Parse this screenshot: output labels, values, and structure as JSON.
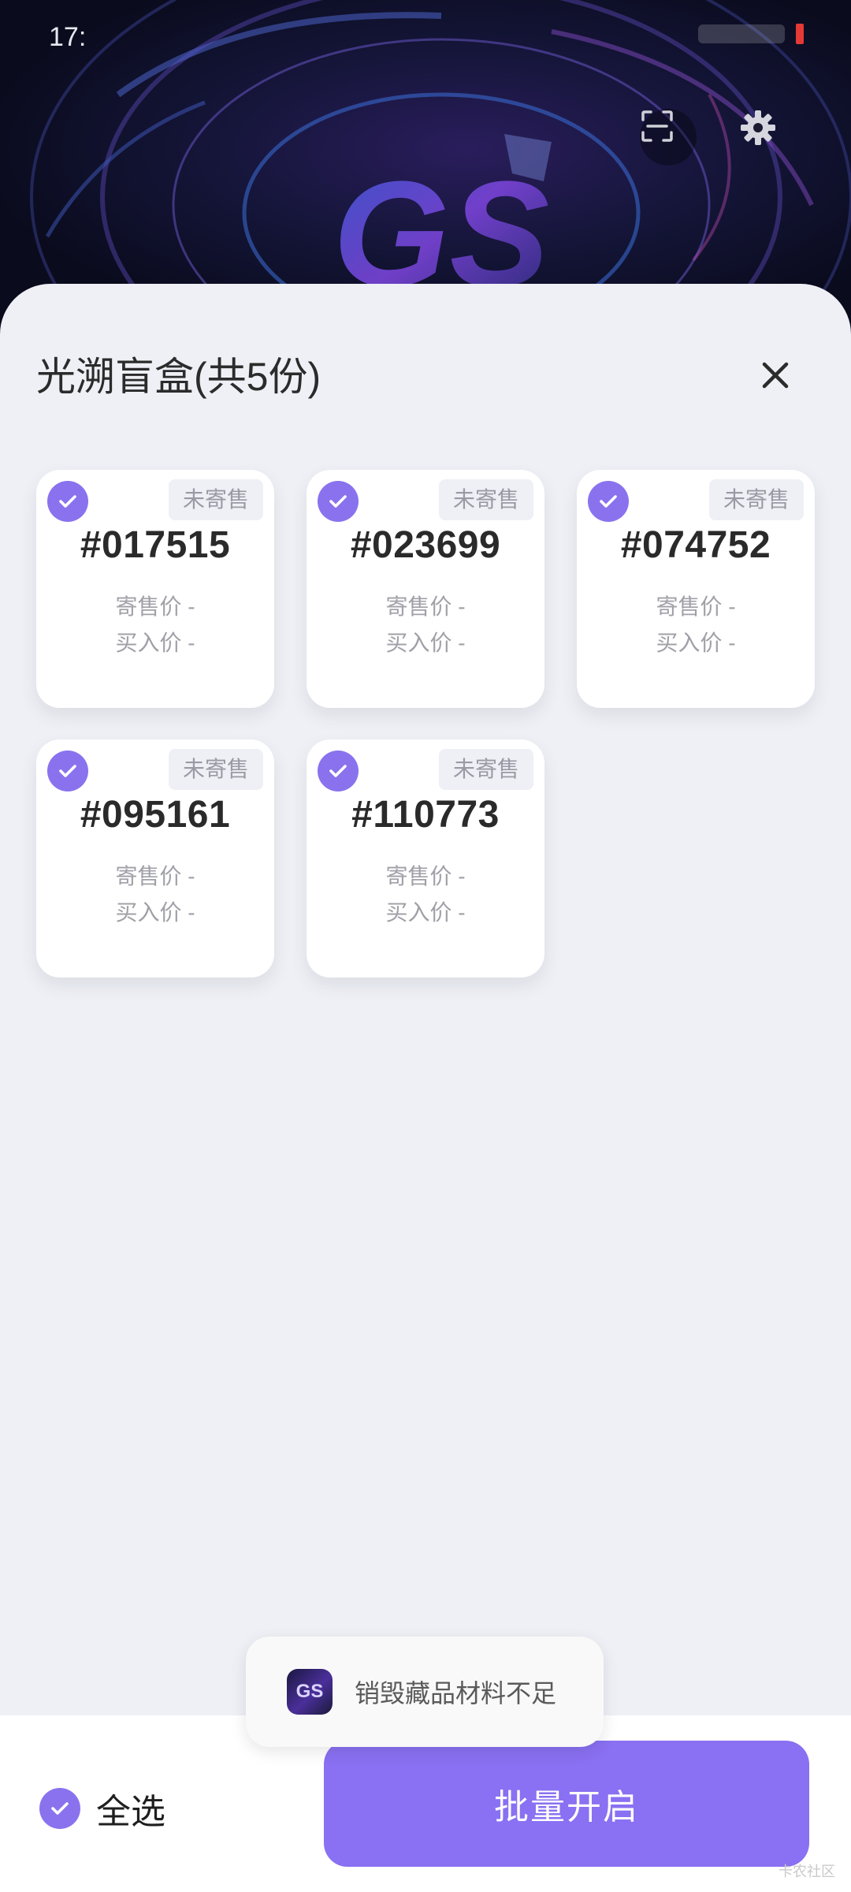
{
  "status_bar": {
    "time": "17:"
  },
  "hero": {
    "logo_text": "GS"
  },
  "sheet": {
    "title": "光溯盲盒(共5份)"
  },
  "cards": [
    {
      "tag": "未寄售",
      "number": "#017515",
      "sale_price": "寄售价 -",
      "buy_price": "买入价 -",
      "selected": true
    },
    {
      "tag": "未寄售",
      "number": "#023699",
      "sale_price": "寄售价 -",
      "buy_price": "买入价 -",
      "selected": true
    },
    {
      "tag": "未寄售",
      "number": "#074752",
      "sale_price": "寄售价 -",
      "buy_price": "买入价 -",
      "selected": true
    },
    {
      "tag": "未寄售",
      "number": "#095161",
      "sale_price": "寄售价 -",
      "buy_price": "买入价 -",
      "selected": true
    },
    {
      "tag": "未寄售",
      "number": "#110773",
      "sale_price": "寄售价 -",
      "buy_price": "买入价 -",
      "selected": true
    }
  ],
  "toast": {
    "icon_text": "GS",
    "message": "销毁藏品材料不足"
  },
  "bottom_bar": {
    "select_all_label": "全选",
    "open_button_label": "批量开启"
  },
  "watermark": "卡农社区",
  "colors": {
    "accent": "#8a70f2",
    "sheet_bg": "#eef0f5"
  }
}
